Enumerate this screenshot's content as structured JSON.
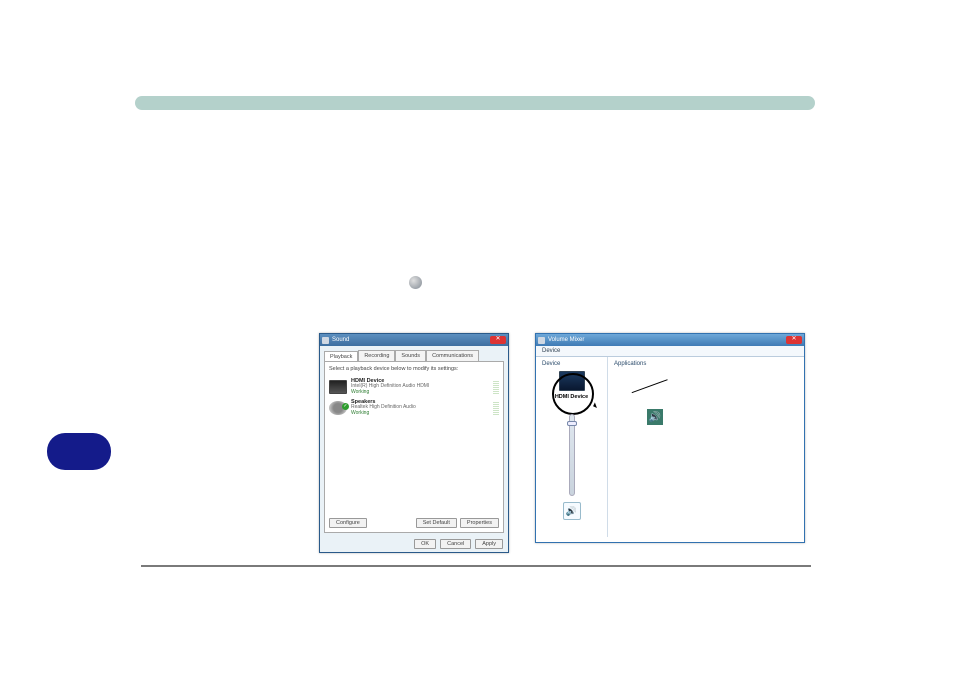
{
  "sound_dialog": {
    "title": "Sound",
    "tabs": [
      "Playback",
      "Recording",
      "Sounds",
      "Communications"
    ],
    "active_tab": 0,
    "instruction": "Select a playback device below to modify its settings:",
    "devices": [
      {
        "name": "HDMI Device",
        "subtitle": "Intel(R) High Definition Audio HDMI",
        "status": "Working",
        "default": true,
        "icon": "monitor"
      },
      {
        "name": "Speakers",
        "subtitle": "Realtek High Definition Audio",
        "status": "Working",
        "default": false,
        "icon": "speaker"
      }
    ],
    "buttons": {
      "configure": "Configure",
      "set_default": "Set Default",
      "properties": "Properties",
      "ok": "OK",
      "cancel": "Cancel",
      "apply": "Apply"
    }
  },
  "mixer_dialog": {
    "title": "Volume Mixer",
    "menu": "Device",
    "device_col_header": "Device",
    "apps_col_header": "Applications",
    "device_label": "HDMI Device",
    "mute_glyph": "🔊"
  }
}
